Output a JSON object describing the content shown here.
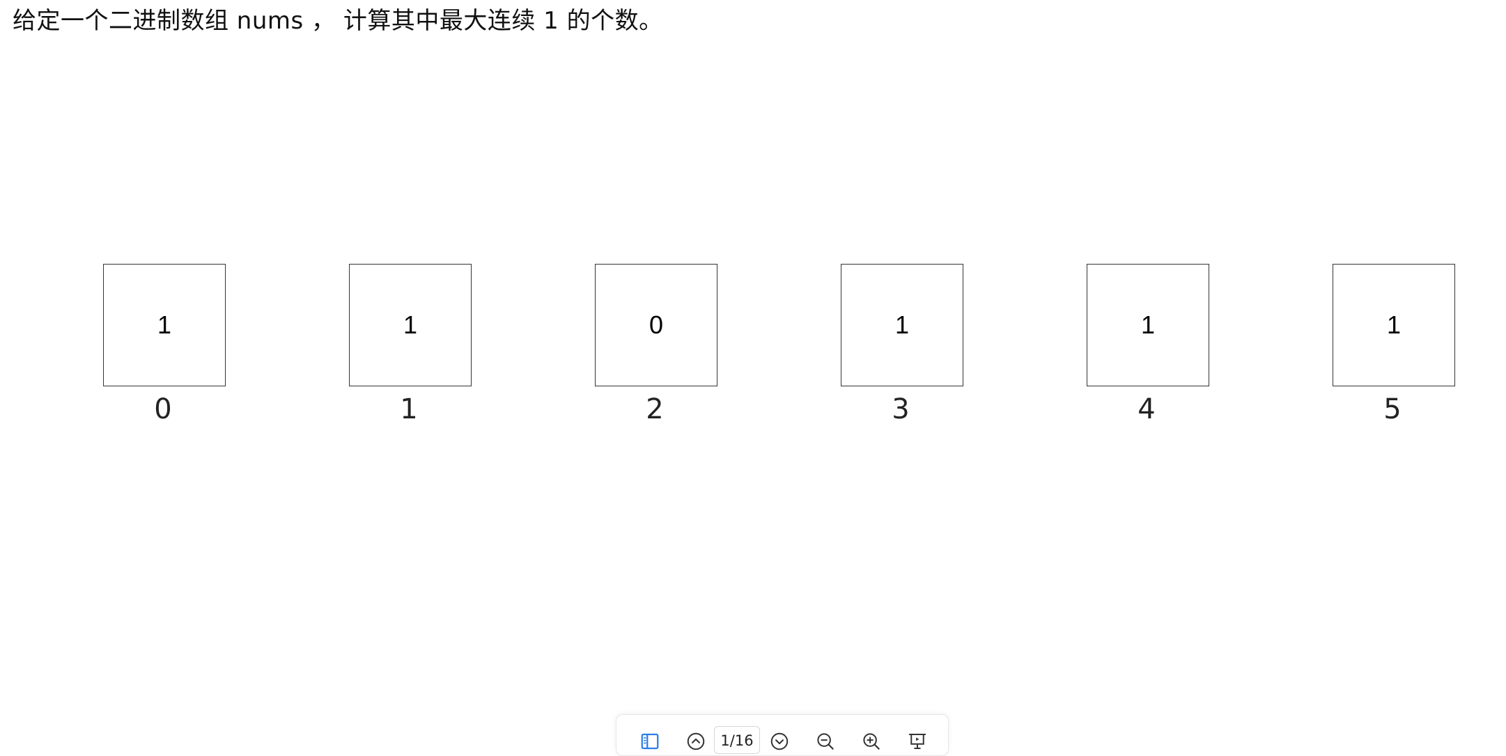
{
  "problem": {
    "text": "给定一个二进制数组 nums ， 计算其中最大连续 1 的个数。"
  },
  "array": {
    "values": [
      "1",
      "1",
      "0",
      "1",
      "1",
      "1"
    ],
    "indices": [
      "0",
      "1",
      "2",
      "3",
      "4",
      "5"
    ]
  },
  "toolbar": {
    "page_indicator": "1/16",
    "icons": {
      "sidebar": "sidebar-toggle-icon",
      "prev": "chevron-up-circle-icon",
      "next": "chevron-down-circle-icon",
      "zoom_out": "zoom-out-icon",
      "zoom_in": "zoom-in-icon",
      "present": "presentation-icon"
    },
    "accent_color": "#2b7de9",
    "icon_color": "#333333"
  }
}
